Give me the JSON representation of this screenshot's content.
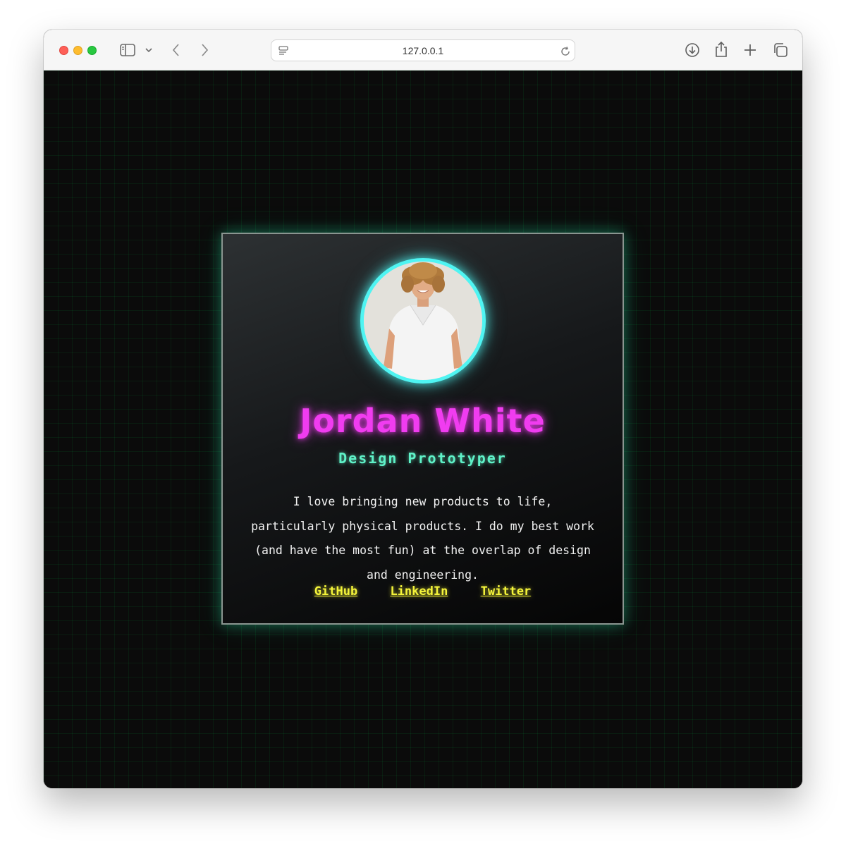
{
  "browser": {
    "url": "127.0.0.1"
  },
  "profile": {
    "name": "Jordan White",
    "role": "Design Prototyper",
    "bio": "I love bringing new products to life, particularly physical products. I do my best work (and have the most fun) at the overlap of design and engineering.",
    "avatar_alt": "Jordan White portrait"
  },
  "links": [
    {
      "label": "GitHub"
    },
    {
      "label": "LinkedIn"
    },
    {
      "label": "Twitter"
    }
  ],
  "colors": {
    "name": "#f03cf0",
    "role": "#5ff2c8",
    "links": "#f4f43a",
    "avatar_ring": "#4ff4f2",
    "background": "#0b0b0b"
  }
}
